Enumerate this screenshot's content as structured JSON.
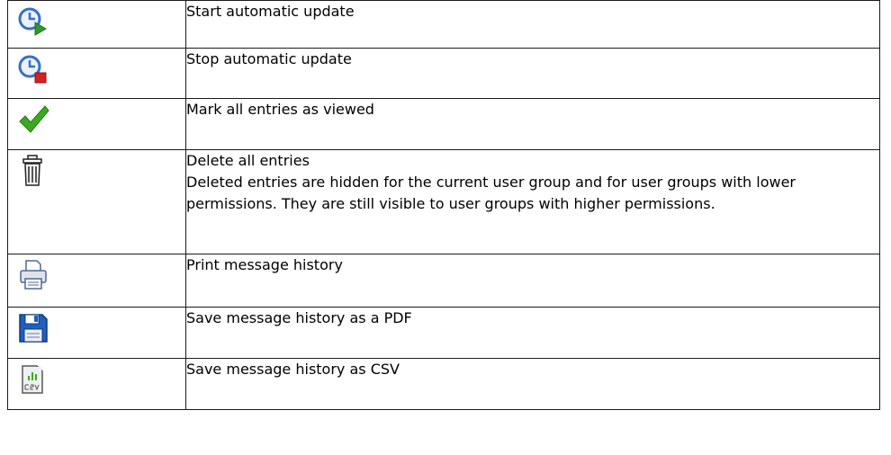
{
  "rows": [
    {
      "icon": "clock-play-icon",
      "lines": [
        "Start automatic update"
      ]
    },
    {
      "icon": "clock-stop-icon",
      "lines": [
        "Stop automatic update"
      ]
    },
    {
      "icon": "checkmark-icon",
      "lines": [
        "Mark all entries as viewed"
      ]
    },
    {
      "icon": "trash-icon",
      "lines": [
        "Delete all entries",
        "Deleted entries are hidden for the current user group and for user groups with lower permissions. They are still visible to user groups with higher permissions."
      ]
    },
    {
      "icon": "printer-icon",
      "lines": [
        "Print message history"
      ]
    },
    {
      "icon": "floppy-disk-icon",
      "lines": [
        "Save message history as a PDF"
      ]
    },
    {
      "icon": "csv-file-icon",
      "lines": [
        "Save message history as CSV"
      ]
    }
  ],
  "colors": {
    "border": "#1a1a1a",
    "clock_blue": "#3a6fc4",
    "play_green": "#2e9a2e",
    "stop_red": "#d42020",
    "check_green": "#3aaa1e",
    "floppy_blue": "#1f5fbf"
  }
}
